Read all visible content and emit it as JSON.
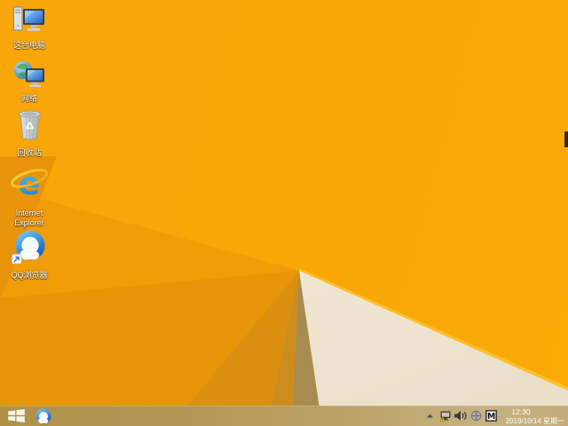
{
  "wallpaper": {
    "base_color": "#F8A607",
    "facet_dark_color": "#E8940B",
    "cream_color": "#F1E8D7",
    "khaki_color": "#A78C50",
    "edge_highlight_color": "#FFC233"
  },
  "desktop": {
    "icons": [
      {
        "label": "这台电脑",
        "icon": "computer-icon"
      },
      {
        "label": "网络",
        "icon": "network-icon"
      },
      {
        "label": "回收站",
        "icon": "recycle-bin-icon"
      },
      {
        "label": "Internet Explorer",
        "icon": "internet-explorer-icon",
        "glyph": "e"
      },
      {
        "label": "QQ浏览器",
        "icon": "qq-browser-icon"
      }
    ]
  },
  "taskbar": {
    "start_button": {
      "icon": "windows-start-icon"
    },
    "pinned": [
      {
        "icon": "qq-browser-icon"
      }
    ],
    "tray": {
      "icons": [
        {
          "name": "show-hidden-icons-arrow"
        },
        {
          "name": "network-status-warning-icon"
        },
        {
          "name": "volume-icon"
        },
        {
          "name": "hardware-icon"
        },
        {
          "name": "ime-indicator-icon"
        }
      ],
      "ime_letter": "M",
      "clock": {
        "time": "12:30",
        "date": "2019/10/14 星期一"
      }
    },
    "colors": {
      "bar_tint": "#B5975A",
      "ie_blue": "#2BA0E0",
      "ie_gold": "#F3B91E",
      "qq_blue": "#2C87DE"
    }
  }
}
